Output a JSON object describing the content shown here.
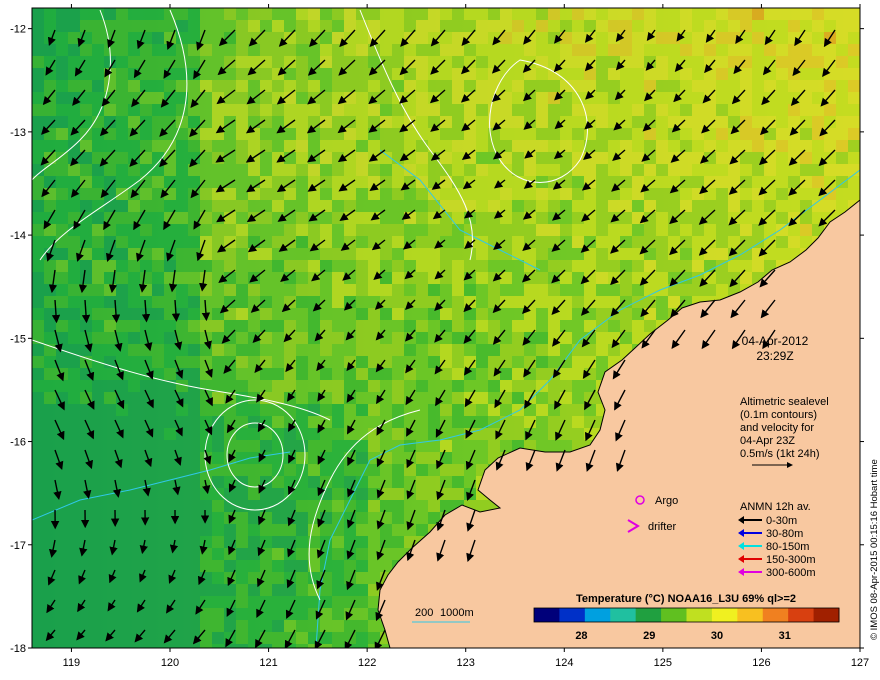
{
  "map": {
    "datetime": {
      "date": "04-Apr-2012",
      "time": "23:29Z"
    },
    "x_axis": {
      "range": [
        118.6,
        127
      ],
      "ticks": [
        "119",
        "120",
        "121",
        "122",
        "123",
        "124",
        "125",
        "126",
        "127"
      ]
    },
    "y_axis": {
      "range": [
        -18,
        -11.8
      ],
      "ticks": [
        "-12",
        "-13",
        "-14",
        "-15",
        "-16",
        "-17",
        "-18"
      ]
    },
    "altimetry_note": [
      "Altimetric sealevel",
      "(0.1m contours)",
      "and velocity for",
      "04-Apr 23Z",
      "0.5m/s (1kt 24h)"
    ],
    "markers": {
      "argo_label": "Argo",
      "drifter_label": "drifter"
    },
    "anmn": {
      "title": "ANMN 12h av.",
      "items": [
        {
          "label": "0-30m",
          "color": "#000000"
        },
        {
          "label": "30-80m",
          "color": "#0000e0"
        },
        {
          "label": "80-150m",
          "color": "#00e0e0"
        },
        {
          "label": "150-300m",
          "color": "#e00000"
        },
        {
          "label": "300-600m",
          "color": "#e000e0"
        }
      ]
    },
    "bathymetry_legend": [
      "200",
      "1000m"
    ],
    "colorbar": {
      "title": "Temperature (°C) NOAA16_L3U 69% ql>=2",
      "range": [
        27.3,
        31.8
      ],
      "ticks": [
        "28",
        "29",
        "30",
        "31"
      ],
      "colors": [
        "#00007a",
        "#0030c8",
        "#00a0e0",
        "#20c0a0",
        "#20a040",
        "#60c020",
        "#c0e020",
        "#f0f020",
        "#f8c020",
        "#f08020",
        "#d84010",
        "#a02000"
      ]
    },
    "credit": "© IMOS 08-Apr-2015 00:15:16 Hobart time",
    "colors": {
      "land": "#f8c8a0",
      "ocean_cool": "#20b040",
      "ocean_warm": "#e0e030"
    }
  }
}
